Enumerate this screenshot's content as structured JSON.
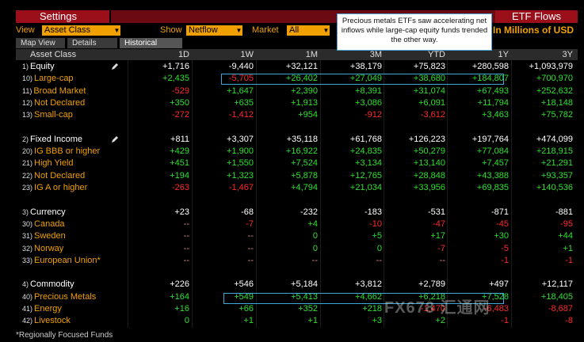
{
  "header": {
    "settings_label": "Settings",
    "title": "ETF Flows"
  },
  "controls": {
    "view_label": "View",
    "view_value": "Asset Class",
    "show_label": "Show",
    "show_value": "Netflow",
    "market_label": "Market",
    "market_value": "All",
    "units": "In Millions of USD"
  },
  "tabs": [
    "Map View",
    "Details",
    "Historical"
  ],
  "callout": "Precious metals ETFs saw accelerating net inflows while large-cap equity funds trended the other way.",
  "columns": [
    "Asset Class",
    "1D",
    "1W",
    "1M",
    "3M",
    "YTD",
    "1Y",
    "3Y"
  ],
  "rows": [
    {
      "idx": "1)",
      "name": "Equity",
      "type": "header",
      "values": [
        "+1,716",
        "-9,440",
        "+32,121",
        "+38,179",
        "+75,823",
        "+280,598",
        "+1,093,979"
      ]
    },
    {
      "idx": "10)",
      "name": "Large-cap",
      "type": "sub",
      "values": [
        "+2,435",
        "-5,705",
        "+26,402",
        "+27,049",
        "+38,680",
        "+184,807",
        "+700,970"
      ]
    },
    {
      "idx": "11)",
      "name": "Broad Market",
      "type": "sub",
      "values": [
        "-529",
        "+1,647",
        "+2,390",
        "+8,391",
        "+31,074",
        "+67,493",
        "+252,632"
      ]
    },
    {
      "idx": "12)",
      "name": "Not Declared",
      "type": "sub",
      "values": [
        "+350",
        "+635",
        "+1,913",
        "+3,086",
        "+6,091",
        "+11,794",
        "+18,148"
      ]
    },
    {
      "idx": "13)",
      "name": "Small-cap",
      "type": "sub",
      "values": [
        "-272",
        "-1,412",
        "+954",
        "-912",
        "-3,612",
        "+3,463",
        "+75,782"
      ]
    },
    {
      "idx": "",
      "name": "",
      "type": "blank",
      "values": []
    },
    {
      "idx": "2)",
      "name": "Fixed Income",
      "type": "header",
      "values": [
        "+811",
        "+3,307",
        "+35,118",
        "+61,768",
        "+126,223",
        "+197,764",
        "+474,099"
      ]
    },
    {
      "idx": "20)",
      "name": "IG BBB or higher",
      "type": "sub",
      "values": [
        "+429",
        "+1,900",
        "+16,922",
        "+24,835",
        "+50,279",
        "+77,084",
        "+218,915"
      ]
    },
    {
      "idx": "21)",
      "name": "High Yield",
      "type": "sub",
      "values": [
        "+451",
        "+1,550",
        "+7,524",
        "+3,134",
        "+13,140",
        "+7,457",
        "+21,291"
      ]
    },
    {
      "idx": "22)",
      "name": "Not Declared",
      "type": "sub",
      "values": [
        "+194",
        "+1,323",
        "+5,878",
        "+12,765",
        "+28,848",
        "+43,388",
        "+93,357"
      ]
    },
    {
      "idx": "23)",
      "name": "IG A or higher",
      "type": "sub",
      "values": [
        "-263",
        "-1,467",
        "+4,794",
        "+21,034",
        "+33,956",
        "+69,835",
        "+140,536"
      ]
    },
    {
      "idx": "",
      "name": "",
      "type": "blank",
      "values": []
    },
    {
      "idx": "3)",
      "name": "Currency",
      "type": "header",
      "values": [
        "+23",
        "-68",
        "-232",
        "-183",
        "-531",
        "-871",
        "-881"
      ]
    },
    {
      "idx": "30)",
      "name": "Canada",
      "type": "sub",
      "values": [
        "--",
        "-7",
        "+4",
        "-10",
        "-47",
        "-45",
        "-95"
      ]
    },
    {
      "idx": "31)",
      "name": "Sweden",
      "type": "sub",
      "values": [
        "--",
        "--",
        "0",
        "+5",
        "+17",
        "+30",
        "+44"
      ]
    },
    {
      "idx": "32)",
      "name": "Norway",
      "type": "sub",
      "values": [
        "--",
        "--",
        "0",
        "0",
        "-7",
        "-5",
        "+1"
      ]
    },
    {
      "idx": "33)",
      "name": "European Union*",
      "type": "sub",
      "values": [
        "--",
        "--",
        "--",
        "--",
        "--",
        "-1",
        "-1"
      ]
    },
    {
      "idx": "",
      "name": "",
      "type": "blank",
      "values": []
    },
    {
      "idx": "4)",
      "name": "Commodity",
      "type": "header",
      "values": [
        "+226",
        "+546",
        "+5,184",
        "+3,812",
        "+2,789",
        "+497",
        "+12,117"
      ]
    },
    {
      "idx": "40)",
      "name": "Precious Metals",
      "type": "sub",
      "values": [
        "+164",
        "+549",
        "+5,413",
        "+4,662",
        "+6,218",
        "+7,528",
        "+18,405"
      ]
    },
    {
      "idx": "41)",
      "name": "Energy",
      "type": "sub",
      "values": [
        "+16",
        "+66",
        "+352",
        "+218",
        "-1,470",
        "-6,483",
        "-8,687"
      ]
    },
    {
      "idx": "42)",
      "name": "Livestock",
      "type": "sub",
      "values": [
        "0",
        "+1",
        "+1",
        "+3",
        "+2",
        "-1",
        "-8"
      ]
    }
  ],
  "footer": "*Regionally Focused Funds",
  "watermark": "FX678 汇通网",
  "colors": {
    "accent_red": "#9b0f1b",
    "amber": "#f0a000",
    "positive": "#2fe02f",
    "negative": "#ff2a2a",
    "highlight": "#3fa9d6"
  }
}
